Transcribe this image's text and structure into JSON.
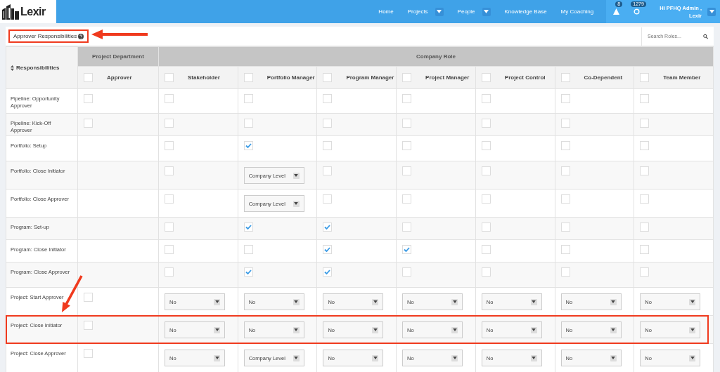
{
  "header": {
    "logo": "Lexir",
    "nav": [
      {
        "label": "Home",
        "dropdown": false
      },
      {
        "label": "Projects",
        "dropdown": true
      },
      {
        "label": "People",
        "dropdown": true
      },
      {
        "label": "Knowledge Base",
        "dropdown": false
      },
      {
        "label": "My Coaching",
        "dropdown": false
      }
    ],
    "alerts_badge": "8",
    "updates_badge": "1279",
    "user": [
      "Hi PFHQ Admin ,",
      "Lexir"
    ]
  },
  "panel": {
    "title": "Approver Responsibilities",
    "highlighted": true,
    "search": {
      "placeholder": "Search Roles..."
    }
  },
  "table": {
    "groups": [
      {
        "label": "Project Department"
      },
      {
        "label": "Company Role"
      }
    ],
    "corner": "Responsibilities",
    "columns": [
      {
        "label": "Approver",
        "checked": false
      },
      {
        "label": "Stakeholder",
        "checked": false
      },
      {
        "label": "Portfolio Manager",
        "checked": false
      },
      {
        "label": "Program Manager",
        "checked": false
      },
      {
        "label": "Project Manager",
        "checked": false
      },
      {
        "label": "Project Control",
        "checked": false
      },
      {
        "label": "Co-Dependent",
        "checked": false
      },
      {
        "label": "Team Member",
        "checked": false
      }
    ],
    "rows": [
      {
        "label": "Pipeline: Opportunity Approver",
        "highlighted": false,
        "cells": [
          {
            "kind": "checkbox",
            "checked": false
          },
          {
            "kind": "checkbox",
            "checked": false
          },
          {
            "kind": "checkbox",
            "checked": false
          },
          {
            "kind": "checkbox",
            "checked": false
          },
          {
            "kind": "checkbox",
            "checked": false
          },
          {
            "kind": "checkbox",
            "checked": false
          },
          {
            "kind": "checkbox",
            "checked": false
          },
          {
            "kind": "checkbox",
            "checked": false
          }
        ]
      },
      {
        "label": "Pipeline: Kick-Off Approver",
        "highlighted": false,
        "cells": [
          {
            "kind": "checkbox",
            "checked": false
          },
          {
            "kind": "checkbox",
            "checked": false
          },
          {
            "kind": "checkbox",
            "checked": false
          },
          {
            "kind": "checkbox",
            "checked": false
          },
          {
            "kind": "checkbox",
            "checked": false
          },
          {
            "kind": "checkbox",
            "checked": false
          },
          {
            "kind": "checkbox",
            "checked": false
          },
          {
            "kind": "checkbox",
            "checked": false
          }
        ]
      },
      {
        "label": "Portfolio: Setup",
        "highlighted": false,
        "cells": [
          {
            "kind": "empty"
          },
          {
            "kind": "checkbox",
            "checked": false
          },
          {
            "kind": "checkbox",
            "checked": true
          },
          {
            "kind": "checkbox",
            "checked": false
          },
          {
            "kind": "checkbox",
            "checked": false
          },
          {
            "kind": "checkbox",
            "checked": false
          },
          {
            "kind": "checkbox",
            "checked": false
          },
          {
            "kind": "checkbox",
            "checked": false
          }
        ]
      },
      {
        "label": "Portfolio: Close Initiator",
        "highlighted": false,
        "cells": [
          {
            "kind": "empty"
          },
          {
            "kind": "checkbox",
            "checked": false
          },
          {
            "kind": "select",
            "value": "Company Level"
          },
          {
            "kind": "checkbox",
            "checked": false
          },
          {
            "kind": "checkbox",
            "checked": false
          },
          {
            "kind": "checkbox",
            "checked": false
          },
          {
            "kind": "checkbox",
            "checked": false
          },
          {
            "kind": "checkbox",
            "checked": false
          }
        ]
      },
      {
        "label": "Portfolio: Close Approver",
        "highlighted": false,
        "cells": [
          {
            "kind": "empty"
          },
          {
            "kind": "checkbox",
            "checked": false
          },
          {
            "kind": "select",
            "value": "Company Level"
          },
          {
            "kind": "checkbox",
            "checked": false
          },
          {
            "kind": "checkbox",
            "checked": false
          },
          {
            "kind": "checkbox",
            "checked": false
          },
          {
            "kind": "checkbox",
            "checked": false
          },
          {
            "kind": "checkbox",
            "checked": false
          }
        ]
      },
      {
        "label": "Program: Set-up",
        "highlighted": false,
        "cells": [
          {
            "kind": "empty"
          },
          {
            "kind": "checkbox",
            "checked": false
          },
          {
            "kind": "checkbox",
            "checked": true
          },
          {
            "kind": "checkbox",
            "checked": true
          },
          {
            "kind": "checkbox",
            "checked": false
          },
          {
            "kind": "checkbox",
            "checked": false
          },
          {
            "kind": "checkbox",
            "checked": false
          },
          {
            "kind": "checkbox",
            "checked": false
          }
        ]
      },
      {
        "label": "Program: Close Initiator",
        "highlighted": false,
        "cells": [
          {
            "kind": "empty"
          },
          {
            "kind": "checkbox",
            "checked": false
          },
          {
            "kind": "checkbox",
            "checked": false
          },
          {
            "kind": "checkbox",
            "checked": true
          },
          {
            "kind": "checkbox",
            "checked": true
          },
          {
            "kind": "checkbox",
            "checked": false
          },
          {
            "kind": "checkbox",
            "checked": false
          },
          {
            "kind": "checkbox",
            "checked": false
          }
        ]
      },
      {
        "label": "Program: Close Approver",
        "highlighted": false,
        "cells": [
          {
            "kind": "empty"
          },
          {
            "kind": "checkbox",
            "checked": false
          },
          {
            "kind": "checkbox",
            "checked": true
          },
          {
            "kind": "checkbox",
            "checked": true
          },
          {
            "kind": "checkbox",
            "checked": false
          },
          {
            "kind": "checkbox",
            "checked": false
          },
          {
            "kind": "checkbox",
            "checked": false
          },
          {
            "kind": "checkbox",
            "checked": false
          }
        ]
      },
      {
        "label": "Project: Start Approver",
        "highlighted": false,
        "cells": [
          {
            "kind": "checkbox",
            "checked": false
          },
          {
            "kind": "select",
            "value": "No"
          },
          {
            "kind": "select",
            "value": "No"
          },
          {
            "kind": "select",
            "value": "No"
          },
          {
            "kind": "select",
            "value": "No"
          },
          {
            "kind": "select",
            "value": "No"
          },
          {
            "kind": "select",
            "value": "No"
          },
          {
            "kind": "select",
            "value": "No"
          }
        ]
      },
      {
        "label": "Project: Close Initiator",
        "highlighted": true,
        "cells": [
          {
            "kind": "checkbox",
            "checked": false
          },
          {
            "kind": "select",
            "value": "No"
          },
          {
            "kind": "select",
            "value": "No"
          },
          {
            "kind": "select",
            "value": "No"
          },
          {
            "kind": "select",
            "value": "No"
          },
          {
            "kind": "select",
            "value": "No"
          },
          {
            "kind": "select",
            "value": "No"
          },
          {
            "kind": "select",
            "value": "No"
          }
        ]
      },
      {
        "label": "Project: Close Approver",
        "highlighted": false,
        "cells": [
          {
            "kind": "checkbox",
            "checked": false
          },
          {
            "kind": "select",
            "value": "No"
          },
          {
            "kind": "select",
            "value": "Company Level"
          },
          {
            "kind": "select",
            "value": "No"
          },
          {
            "kind": "select",
            "value": "No"
          },
          {
            "kind": "select",
            "value": "No"
          },
          {
            "kind": "select",
            "value": "No"
          },
          {
            "kind": "select",
            "value": "No"
          }
        ]
      }
    ]
  }
}
